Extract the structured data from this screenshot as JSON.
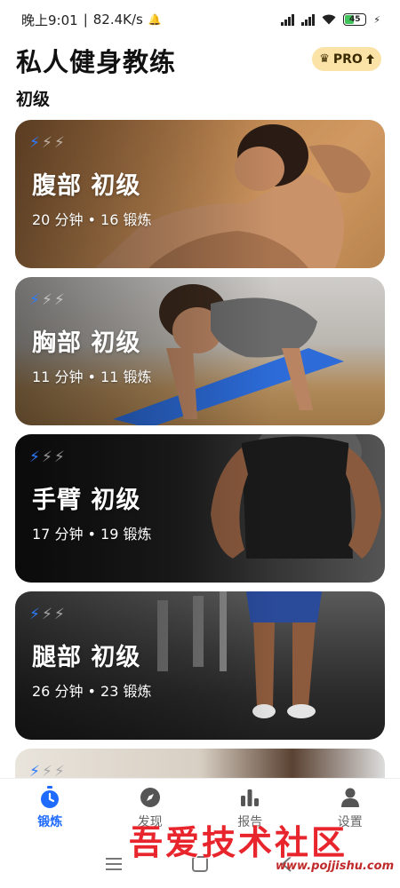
{
  "status_bar": {
    "time": "晚上9:01",
    "separator": "|",
    "speed": "82.4K/s",
    "battery": "45"
  },
  "header": {
    "title": "私人健身教练",
    "pro_label": "PRO"
  },
  "section": {
    "title": "初级"
  },
  "cards": [
    {
      "title": "腹部 初级",
      "meta": "20 分钟 • 16 锻炼",
      "level": 1,
      "level_max": 3
    },
    {
      "title": "胸部 初级",
      "meta": "11 分钟 • 11 锻炼",
      "level": 1,
      "level_max": 3
    },
    {
      "title": "手臂 初级",
      "meta": "17 分钟 • 19 锻炼",
      "level": 1,
      "level_max": 3
    },
    {
      "title": "腿部 初级",
      "meta": "26 分钟 • 23 锻炼",
      "level": 1,
      "level_max": 3
    },
    {
      "title": "",
      "meta": "",
      "level": 1,
      "level_max": 3
    }
  ],
  "bottom_nav": {
    "items": [
      {
        "label": "锻炼",
        "icon": "stopwatch-icon",
        "active": true
      },
      {
        "label": "发现",
        "icon": "compass-icon",
        "active": false
      },
      {
        "label": "报告",
        "icon": "bar-chart-icon",
        "active": false
      },
      {
        "label": "设置",
        "icon": "person-icon",
        "active": false
      }
    ]
  },
  "watermark": {
    "text": "吾爱技术社区",
    "url": "www.pojjishu.com"
  },
  "colors": {
    "accent": "#1f6bff",
    "pro_badge": "#fbe3a8",
    "bolt_active": "#2f7bff"
  }
}
